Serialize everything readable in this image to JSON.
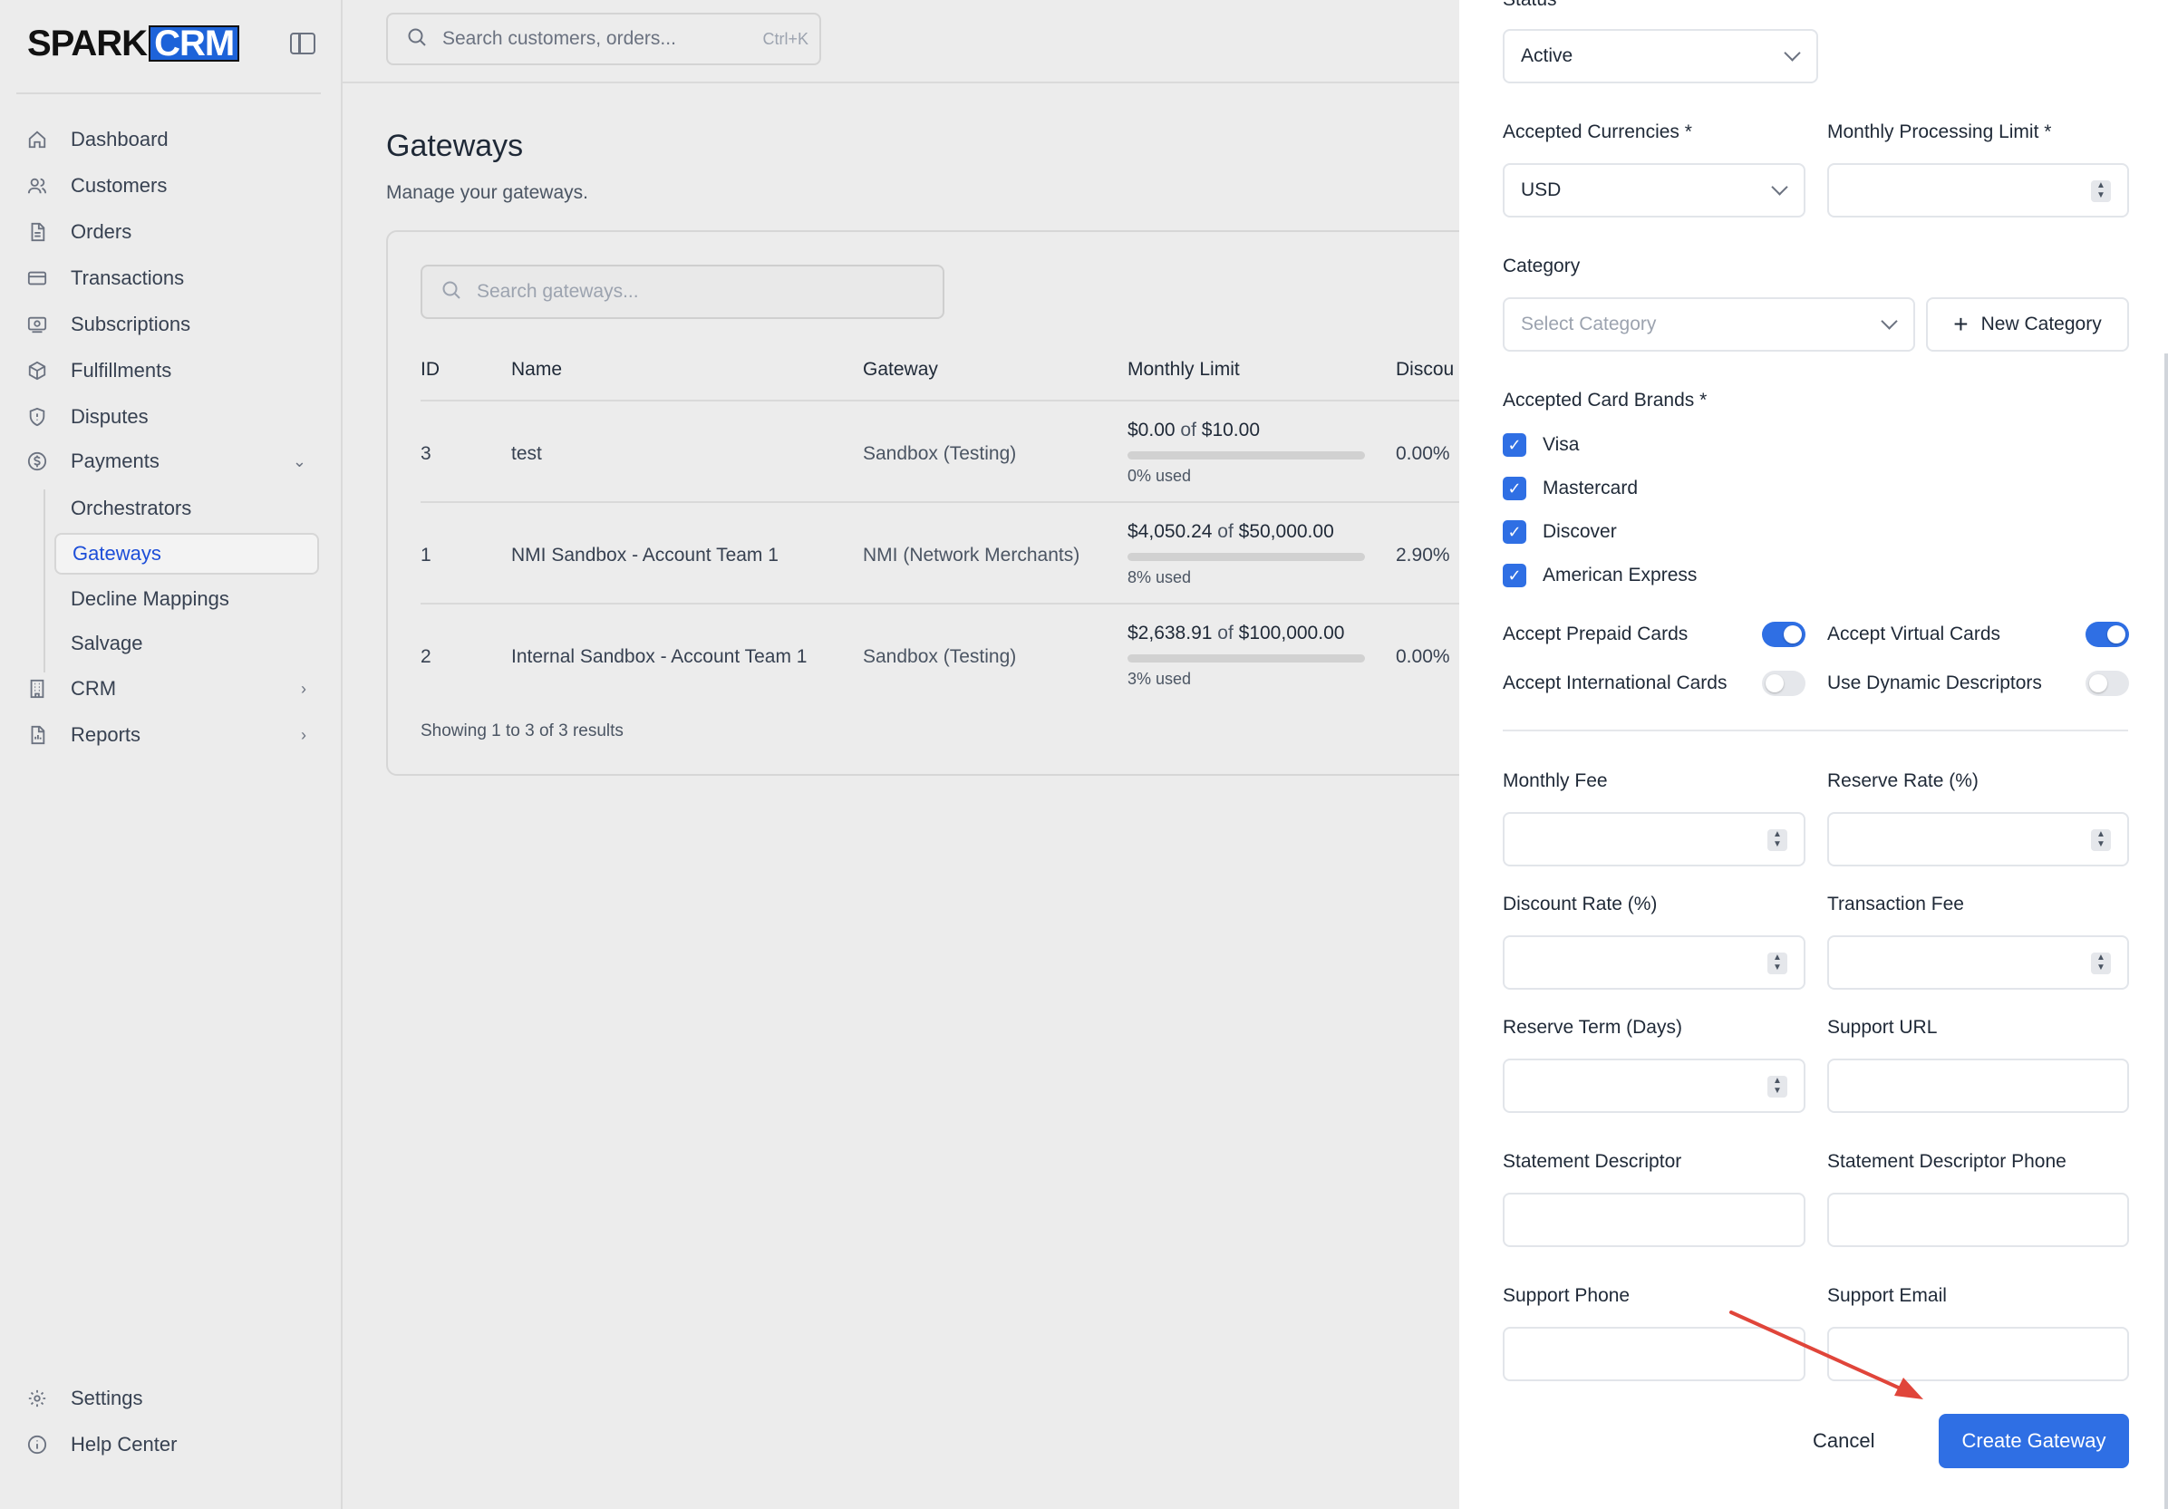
{
  "sidebar": {
    "logo_spark": "SPARK",
    "logo_crm": "CRM",
    "items": [
      {
        "label": "Dashboard",
        "icon": "home-icon"
      },
      {
        "label": "Customers",
        "icon": "users-icon"
      },
      {
        "label": "Orders",
        "icon": "file-icon"
      },
      {
        "label": "Transactions",
        "icon": "credit-card-icon"
      },
      {
        "label": "Subscriptions",
        "icon": "subscription-icon"
      },
      {
        "label": "Fulfillments",
        "icon": "package-icon"
      },
      {
        "label": "Disputes",
        "icon": "shield-icon"
      },
      {
        "label": "Payments",
        "icon": "dollar-circle-icon"
      }
    ],
    "payments_sub": [
      "Orchestrators",
      "Gateways",
      "Decline Mappings",
      "Salvage"
    ],
    "crm": "CRM",
    "reports": "Reports",
    "settings": "Settings",
    "help": "Help Center"
  },
  "topbar": {
    "search_placeholder": "Search customers, orders...",
    "shortcut": "Ctrl+K"
  },
  "main": {
    "title": "Gateways",
    "subtitle": "Manage your gateways.",
    "search_placeholder": "Search gateways...",
    "columns": [
      "ID",
      "Name",
      "Gateway",
      "Monthly Limit",
      "Discou"
    ],
    "rows": [
      {
        "id": "3",
        "name": "test",
        "gateway": "Sandbox (Testing)",
        "used_amount": "$0.00",
        "of": "of",
        "limit": "$10.00",
        "used_label": "0% used",
        "used_pct": 0,
        "discount": "0.00%"
      },
      {
        "id": "1",
        "name": "NMI Sandbox - Account Team 1",
        "gateway": "NMI (Network Merchants)",
        "used_amount": "$4,050.24",
        "of": "of",
        "limit": "$50,000.00",
        "used_label": "8% used",
        "used_pct": 8,
        "discount": "2.90%"
      },
      {
        "id": "2",
        "name": "Internal Sandbox - Account Team 1",
        "gateway": "Sandbox (Testing)",
        "used_amount": "$2,638.91",
        "of": "of",
        "limit": "$100,000.00",
        "used_label": "3% used",
        "used_pct": 3,
        "discount": "0.00%"
      }
    ],
    "showing": "Showing 1 to 3 of 3 results"
  },
  "drawer": {
    "status_label": "Status *",
    "status_value": "Active",
    "currencies_label": "Accepted Currencies *",
    "currencies_value": "USD",
    "limit_label": "Monthly Processing Limit *",
    "category_label": "Category",
    "category_placeholder": "Select Category",
    "new_category": "New Category",
    "brands_label": "Accepted Card Brands *",
    "brands": [
      "Visa",
      "Mastercard",
      "Discover",
      "American Express"
    ],
    "toggles": [
      {
        "label": "Accept Prepaid Cards",
        "on": true
      },
      {
        "label": "Accept Virtual Cards",
        "on": true
      },
      {
        "label": "Accept International Cards",
        "on": false
      },
      {
        "label": "Use Dynamic Descriptors",
        "on": false
      }
    ],
    "fields": [
      "Monthly Fee",
      "Reserve Rate (%)",
      "Discount Rate (%)",
      "Transaction Fee",
      "Reserve Term (Days)",
      "Support URL",
      "Statement Descriptor",
      "Statement Descriptor Phone",
      "Support Phone",
      "Support Email"
    ],
    "cancel": "Cancel",
    "create": "Create Gateway"
  },
  "colors": {
    "accent": "#2f6fe4",
    "progress": "#16a34a",
    "annotation": "#e0453a"
  }
}
